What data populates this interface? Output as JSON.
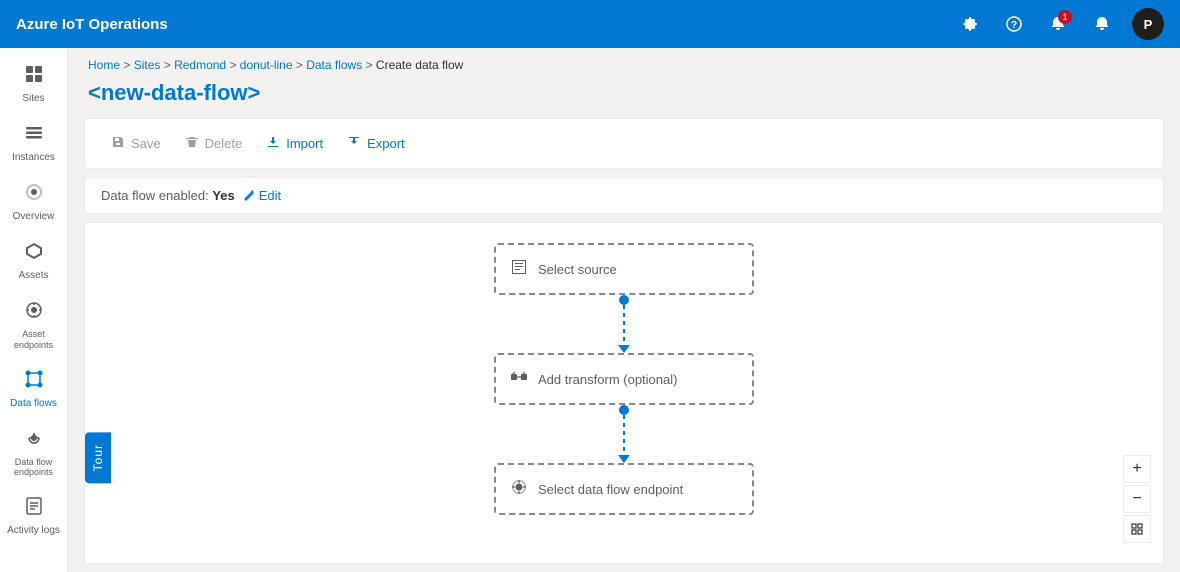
{
  "topbar": {
    "title": "Azure IoT Operations",
    "icons": {
      "settings": "⚙",
      "help": "?",
      "notifications1": "🔔",
      "notifications2": "🔔",
      "avatar": "P"
    },
    "badge": "1"
  },
  "sidebar": {
    "items": [
      {
        "id": "sites",
        "label": "Sites",
        "icon": "⊞",
        "active": false
      },
      {
        "id": "instances",
        "label": "Instances",
        "icon": "☰",
        "active": false
      },
      {
        "id": "overview",
        "label": "Overview",
        "icon": "⬡",
        "active": false
      },
      {
        "id": "assets",
        "label": "Assets",
        "icon": "◈",
        "active": false
      },
      {
        "id": "asset-endpoints",
        "label": "Asset endpoints",
        "icon": "⬡",
        "active": false
      },
      {
        "id": "data-flows",
        "label": "Data flows",
        "icon": "⟺",
        "active": true
      },
      {
        "id": "data-flow-endpoints",
        "label": "Data flow endpoints",
        "icon": "⬡",
        "active": false
      },
      {
        "id": "activity-logs",
        "label": "Activity logs",
        "icon": "📋",
        "active": false
      }
    ]
  },
  "breadcrumb": {
    "items": [
      "Home",
      "Sites",
      "Redmond",
      "donut-line",
      "Data flows"
    ],
    "current": "Create data flow",
    "separator": ">"
  },
  "page_title": "<new-data-flow>",
  "toolbar": {
    "save_label": "Save",
    "delete_label": "Delete",
    "import_label": "Import",
    "export_label": "Export"
  },
  "status": {
    "label": "Data flow enabled:",
    "value": "Yes",
    "edit_label": "Edit"
  },
  "flow": {
    "source_label": "Select source",
    "transform_label": "Add transform (optional)",
    "endpoint_label": "Select data flow endpoint"
  },
  "zoom": {
    "plus": "+",
    "minus": "−",
    "reset": "⬚"
  },
  "tour": {
    "label": "Tour"
  }
}
